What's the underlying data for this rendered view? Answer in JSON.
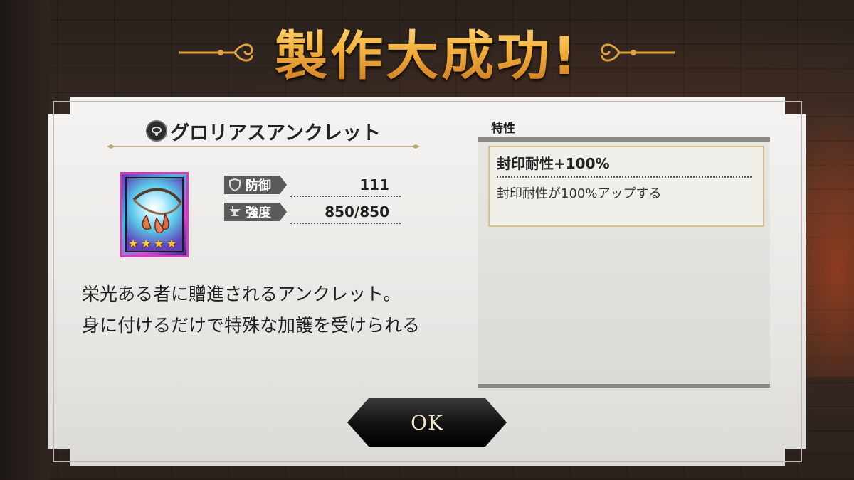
{
  "title": "製作大成功!",
  "item": {
    "name": "グロリアスアンクレット",
    "type_icon": "anklet-icon",
    "rarity_stars": 4,
    "stats": [
      {
        "label": "防御",
        "icon": "shield-icon",
        "value": "111"
      },
      {
        "label": "強度",
        "icon": "anvil-icon",
        "value": "850/850"
      }
    ],
    "description": "栄光ある者に贈進されるアンクレット。\n身に付けるだけで特殊な加護を受けられる"
  },
  "traits": {
    "header": "特性",
    "items": [
      {
        "name": "封印耐性+100%",
        "description": "封印耐性が100%アップする"
      }
    ]
  },
  "ok_button": {
    "label": "OK"
  },
  "colors": {
    "title_gold": "#f5b440",
    "trait_border": "#d6c38f",
    "rarity_frame": "#d23ab8"
  }
}
